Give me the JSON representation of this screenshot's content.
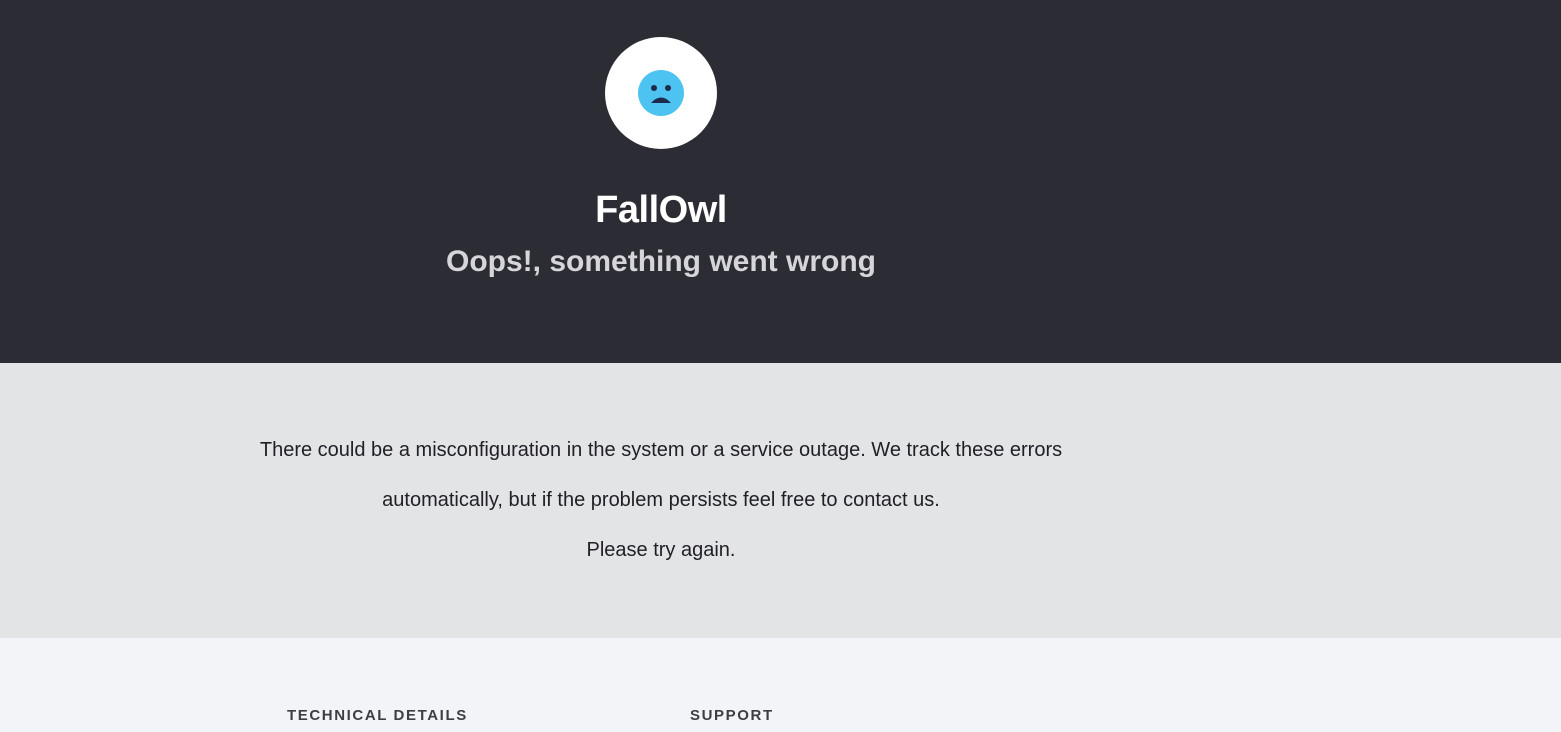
{
  "header": {
    "logo_icon": "sad-face-icon",
    "brand": "FallOwl",
    "subtitle": "Oops!, something went wrong"
  },
  "message": {
    "line1": "There could be a misconfiguration in the system or a service outage. We track these errors",
    "line2": "automatically, but if the problem persists feel free to contact us.",
    "line3": "Please try again."
  },
  "footer": {
    "technical_details": "TECHNICAL DETAILS",
    "support": "SUPPORT"
  },
  "colors": {
    "header_bg": "#2c2c35",
    "message_bg": "#e3e4e6",
    "footer_bg": "#f3f4f8",
    "face": "#4cc3f0",
    "face_features": "#1e2a4a"
  }
}
